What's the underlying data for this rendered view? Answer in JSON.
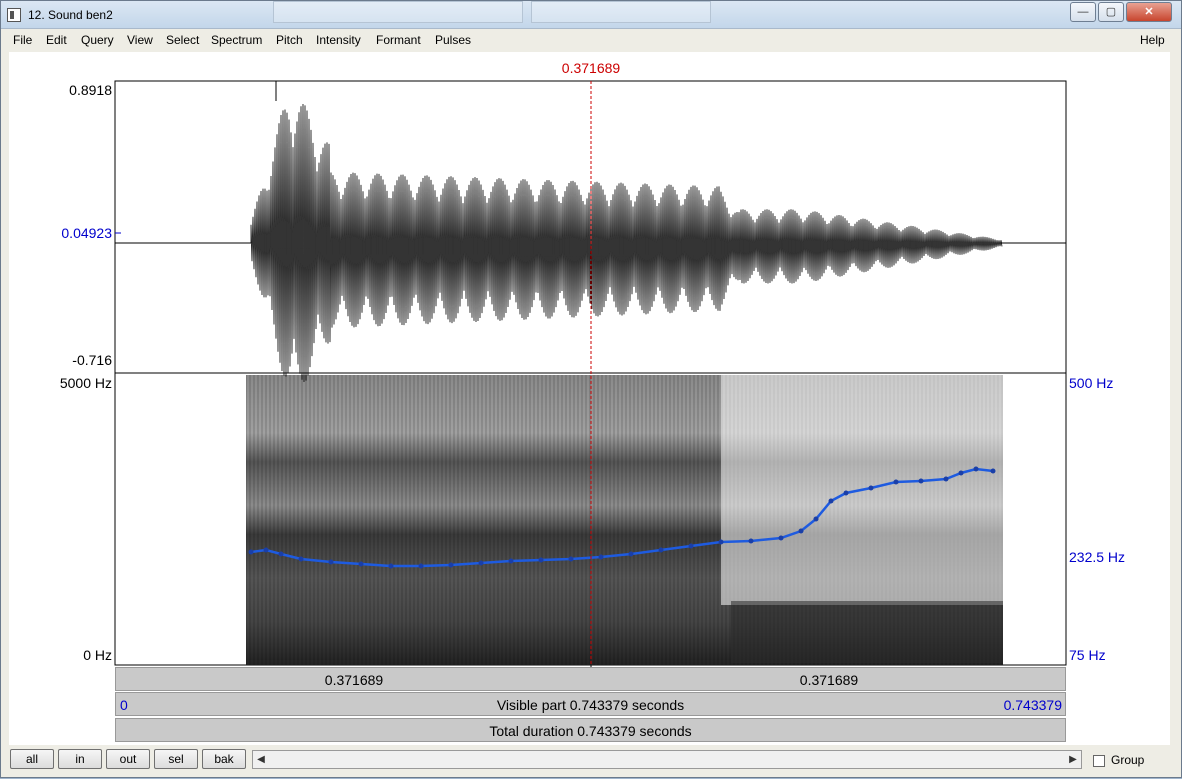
{
  "window": {
    "title": "12. Sound ben2"
  },
  "menu": [
    "File",
    "Edit",
    "Query",
    "View",
    "Select",
    "Spectrum",
    "Pitch",
    "Intensity",
    "Formant",
    "Pulses"
  ],
  "help_label": "Help",
  "cursor_time": "0.371689",
  "waveform": {
    "max_label": "0.8918",
    "cursor_value_label": "0.04923",
    "min_label": "-0.716"
  },
  "spectrogram": {
    "freq_top": "5000 Hz",
    "freq_bottom": "0 Hz",
    "pitch_top": "500 Hz",
    "pitch_mid": "232.5 Hz",
    "pitch_bottom": "75 Hz"
  },
  "time_bar": {
    "left_part": "0.371689",
    "right_part": "0.371689"
  },
  "visible": {
    "start": "0",
    "label": "Visible part 0.743379 seconds",
    "end": "0.743379"
  },
  "total": {
    "label": "Total duration 0.743379 seconds"
  },
  "buttons": {
    "all": "all",
    "in": "in",
    "out": "out",
    "sel": "sel",
    "bak": "bak"
  },
  "group_label": "Group",
  "colors": {
    "cursor": "#cc0000",
    "pitch_track": "#1e5be0",
    "axis_blue": "#0000cc"
  }
}
